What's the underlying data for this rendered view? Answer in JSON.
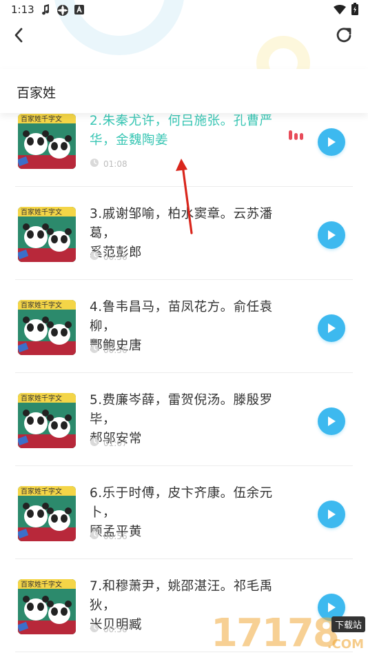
{
  "status_bar": {
    "time": "1:13",
    "icons": [
      "music-note-icon",
      "settings-app-icon",
      "a-box-icon",
      "wifi-icon",
      "battery-icon"
    ]
  },
  "nav": {
    "back_icon": "chevron-left-icon",
    "refresh_icon": "refresh-icon"
  },
  "header": {
    "title": "百家姓"
  },
  "tracks": [
    {
      "line1": "2.朱秦尤许，何吕施张。孔曹严",
      "line2": "华，金魏陶姜",
      "duration": "01:08",
      "active": true
    },
    {
      "line1": "3.戚谢邹喻，柏水窦章。云苏潘葛，",
      "line2": "奚范彭郎",
      "duration": "00:56",
      "active": false
    },
    {
      "line1": "4.鲁韦昌马，苗凤花方。俞任袁柳，",
      "line2": "酆鲍史唐",
      "duration": "00:56",
      "active": false
    },
    {
      "line1": "5.费廉岑薛，雷贺倪汤。滕殷罗毕，",
      "line2": "郝邬安常",
      "duration": "01:07",
      "active": false
    },
    {
      "line1": "6.乐于时傅，皮卞齐康。伍余元卜，",
      "line2": "顾孟平黄",
      "duration": "00:56",
      "active": false
    },
    {
      "line1": "7.和穆萧尹，姚邵湛汪。祁毛禹狄，",
      "line2": "米贝明臧",
      "duration": "00:56",
      "active": false
    }
  ],
  "colors": {
    "active_text": "#39c6b4",
    "play_button": "#3db9ef",
    "equalizer": "#e84c5a",
    "annotation_arrow": "#d9261c"
  },
  "watermark": {
    "text": "17178",
    "badge": "下载站",
    "suffix": ".COM"
  }
}
